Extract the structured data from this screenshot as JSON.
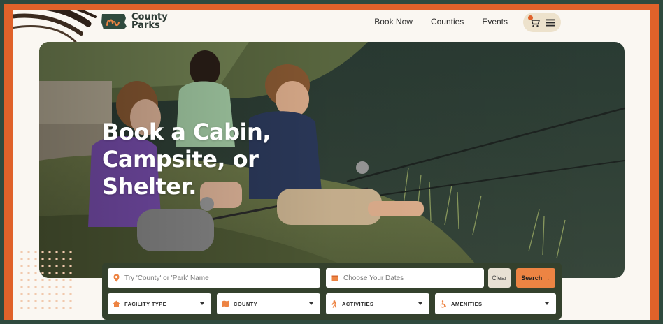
{
  "brand": {
    "line1": "County",
    "line2": "Parks",
    "mark_text": "My"
  },
  "nav": {
    "items": [
      "Book Now",
      "Counties",
      "Events"
    ],
    "cart_icon": "cart-icon",
    "menu_icon": "hamburger-menu-icon"
  },
  "hero": {
    "title_line1": "Book a Cabin,",
    "title_line2": "Campsite, or",
    "title_line3": "Shelter."
  },
  "search": {
    "location_placeholder": "Try 'County' or 'Park' Name",
    "dates_placeholder": "Choose Your Dates",
    "clear_label": "Clear",
    "search_label": "Search →",
    "filters": {
      "facility_type": "FACILITY TYPE",
      "county": "COUNTY",
      "activities": "ACTIVITIES",
      "amenities": "AMENITIES"
    }
  },
  "colors": {
    "frame": "#2f4a3e",
    "accent": "#e0622a",
    "search_button": "#ed8443",
    "panel": "#34412d",
    "pill": "#ede2cc"
  }
}
